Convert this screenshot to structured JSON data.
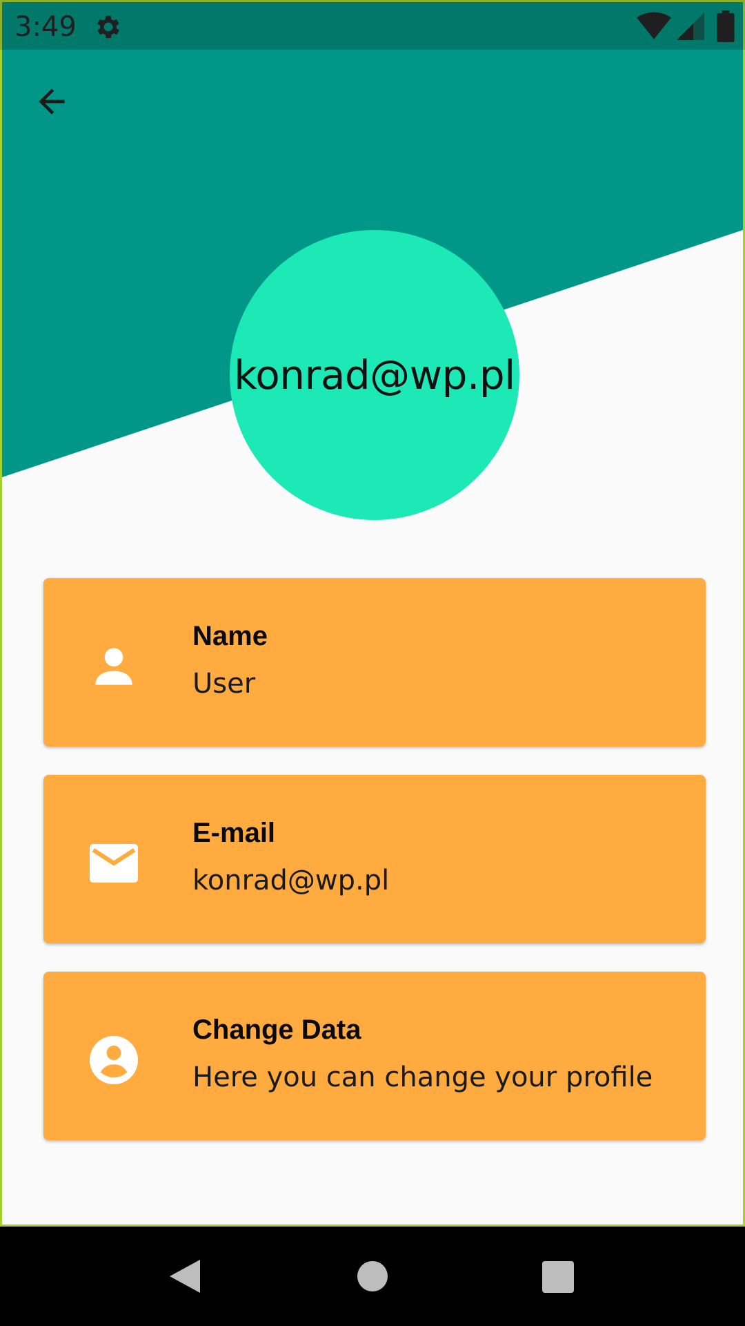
{
  "status_bar": {
    "time": "3:49"
  },
  "icons": {
    "back": "arrow-left-icon",
    "settings": "gear-icon",
    "wifi": "wifi-icon",
    "signal": "cell-signal-icon",
    "battery": "battery-icon",
    "person": "person-icon",
    "email": "envelope-icon",
    "account": "account-circle-icon"
  },
  "colors": {
    "header": "#009688",
    "status_bar": "#00796b",
    "avatar": "#1de9b6",
    "card": "#ffab40",
    "background": "#fafafa"
  },
  "profile": {
    "avatar_text": "konrad@wp.pl"
  },
  "cards": [
    {
      "title": "Name",
      "value": "User"
    },
    {
      "title": "E-mail",
      "value": "konrad@wp.pl"
    },
    {
      "title": "Change Data",
      "value": "Here you can change your profile"
    }
  ]
}
